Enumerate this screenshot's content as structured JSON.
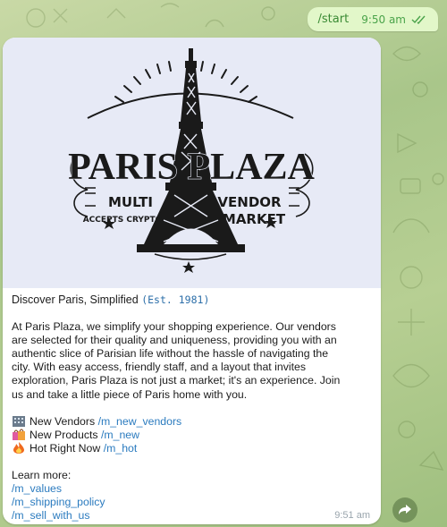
{
  "outgoing": {
    "command": "/start",
    "time": "9:50 am"
  },
  "banner": {
    "title": "PARIS PLAZA",
    "left_top": "MULTI",
    "right_top": "VENDOR",
    "left_bottom": "ACCEPTS CRYPTO",
    "right_bottom": "MARKET"
  },
  "message": {
    "heading": "Discover Paris, Simplified",
    "heading_mono": "(Est. 1981)",
    "paragraph_lines": [
      "At Paris Plaza, we simplify your shopping experience. Our vendors",
      "are selected for their quality and uniqueness, providing you with an",
      "authentic slice of Parisian life without the hassle of navigating the",
      "city. With easy access, friendly staff, and a layout that invites",
      "exploration, Paris Plaza is not just a market; it's an experience. Join",
      "us and take a little piece of Paris home with you."
    ],
    "links": [
      {
        "icon": "building-icon",
        "label": "New Vendors",
        "cmd": "/m_new_vendors"
      },
      {
        "icon": "shopping-bags-icon",
        "label": "New Products",
        "cmd": "/m_new"
      },
      {
        "icon": "fire-icon",
        "label": "Hot Right Now",
        "cmd": "/m_hot"
      }
    ],
    "learn_more": "Learn more:",
    "learn_links": [
      "/m_values",
      "/m_shipping_policy",
      "/m_sell_with_us"
    ],
    "time": "9:51 am"
  }
}
